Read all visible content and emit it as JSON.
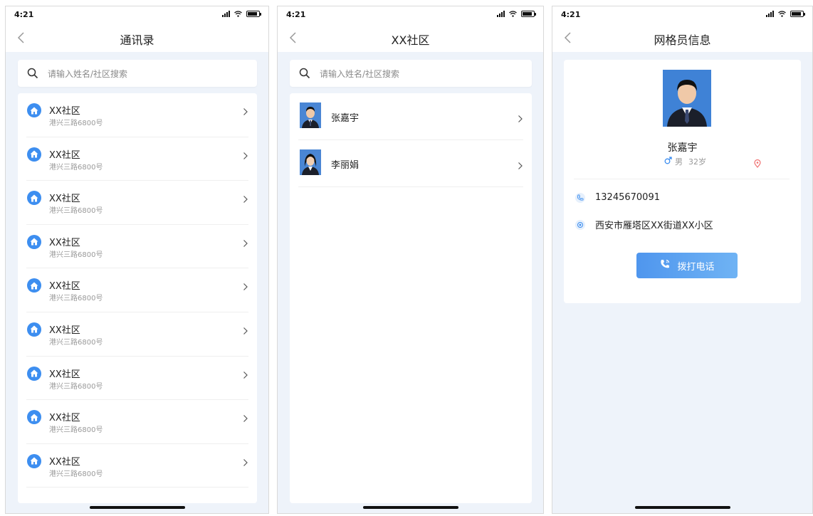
{
  "status": {
    "time": "4:21"
  },
  "screen1": {
    "title": "通讯录",
    "search_placeholder": "请输入姓名/社区搜索",
    "items": [
      {
        "name": "XX社区",
        "address": "港兴三路6800号"
      },
      {
        "name": "XX社区",
        "address": "港兴三路6800号"
      },
      {
        "name": "XX社区",
        "address": "港兴三路6800号"
      },
      {
        "name": "XX社区",
        "address": "港兴三路6800号"
      },
      {
        "name": "XX社区",
        "address": "港兴三路6800号"
      },
      {
        "name": "XX社区",
        "address": "港兴三路6800号"
      },
      {
        "name": "XX社区",
        "address": "港兴三路6800号"
      },
      {
        "name": "XX社区",
        "address": "港兴三路6800号"
      },
      {
        "name": "XX社区",
        "address": "港兴三路6800号"
      }
    ]
  },
  "screen2": {
    "title": "XX社区",
    "search_placeholder": "请输入姓名/社区搜索",
    "people": [
      {
        "name": "张嘉宇",
        "gender": "male"
      },
      {
        "name": "李丽娟",
        "gender": "female"
      }
    ]
  },
  "screen3": {
    "title": "网格员信息",
    "name": "张嘉宇",
    "gender": "男",
    "age": "32岁",
    "phone": "13245670091",
    "address": "西安市雁塔区XX街道XX小区",
    "call_label": "拨打电话"
  },
  "colors": {
    "accent": "#3d8ef0",
    "background": "#eef3fa",
    "pin": "#f07070"
  },
  "icons": {
    "back": "chevron-left-icon",
    "search": "search-icon",
    "community": "home-icon",
    "row_arrow": "chevron-right-icon",
    "phone": "phone-icon",
    "location": "location-icon",
    "gender": "male-icon",
    "map_pin": "map-pin-icon"
  }
}
